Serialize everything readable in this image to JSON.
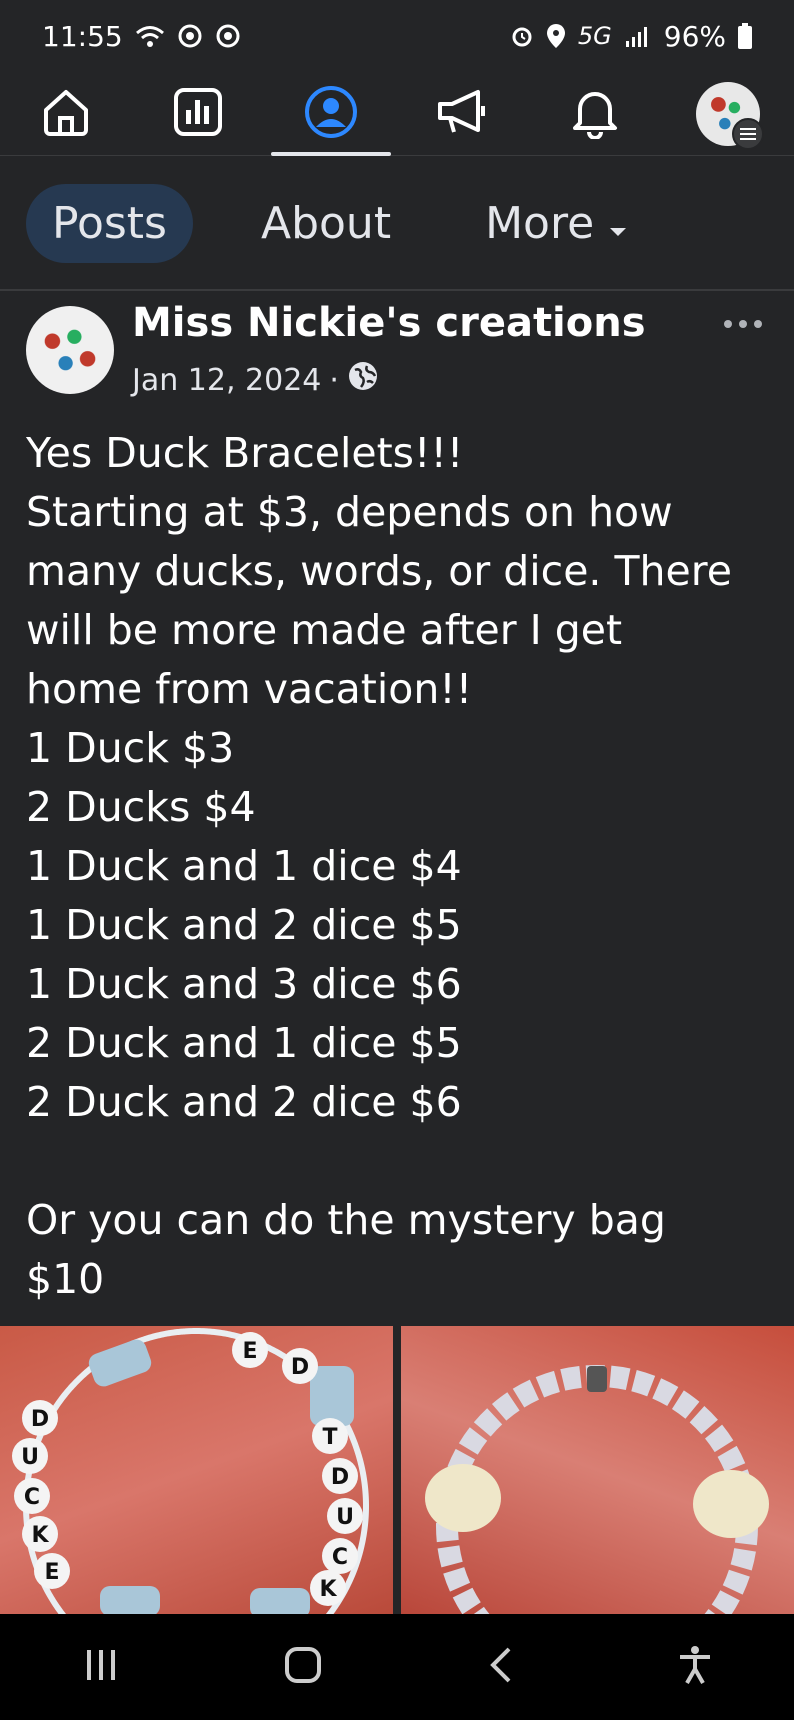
{
  "status_bar": {
    "time": "11:55",
    "network": "5G",
    "battery": "96%"
  },
  "nav": {
    "items": [
      "home-icon",
      "dashboard-icon",
      "profile-icon",
      "megaphone-icon",
      "bell-icon",
      "avatar"
    ],
    "active_index": 2,
    "accent": "#2d88ff"
  },
  "tabs": {
    "posts": "Posts",
    "about": "About",
    "more": "More"
  },
  "post": {
    "author": "Miss Nickie's creations",
    "date": "Jan 12, 2024",
    "separator": "·",
    "lines": [
      "Yes Duck Bracelets!!!",
      "Starting at $3, depends on how",
      "many ducks, words, or dice. There",
      "will be more made after I get",
      "home from vacation!!",
      "1 Duck $3",
      "2 Ducks $4",
      "1 Duck and 1 dice $4",
      "1 Duck and 2 dice $5",
      "1 Duck and 3 dice $6",
      "2 Duck and 1 dice $5",
      "2 Duck and 2 dice $6",
      "",
      "Or you can do the mystery bag",
      "$10"
    ],
    "photo1_beads": [
      "D",
      "U",
      "C",
      "K",
      "E",
      "T",
      "D",
      "U",
      "C",
      "K",
      "E",
      "D"
    ]
  }
}
